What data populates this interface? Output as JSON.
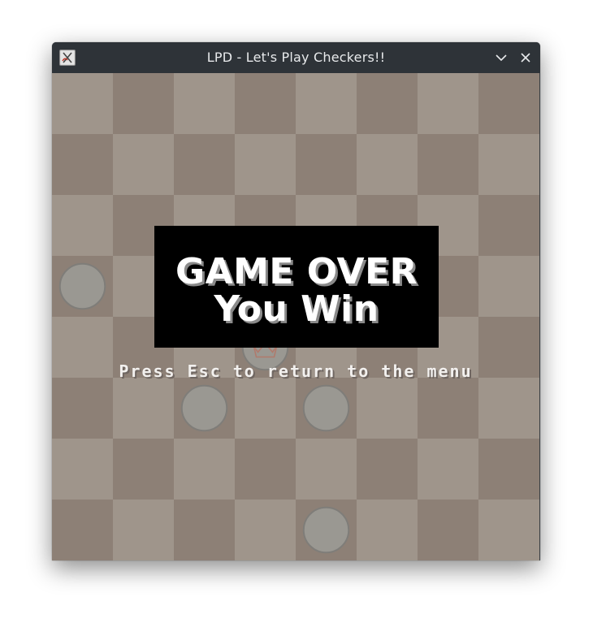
{
  "window": {
    "title": "LPD - Let's Play Checkers!!",
    "icon": "app-icon",
    "controls": [
      "minimize-chevron-icon",
      "close-icon"
    ]
  },
  "board": {
    "rows": 8,
    "cols": 8,
    "light_color": "#9f958b",
    "dark_color": "#8d8076",
    "piece_color": "#9a9892",
    "piece_border": "#7f7d79",
    "crown_color": "#b07a6c",
    "pieces": [
      {
        "row": 3,
        "col": 0,
        "king": false
      },
      {
        "row": 4,
        "col": 3,
        "king": true
      },
      {
        "row": 5,
        "col": 2,
        "king": false
      },
      {
        "row": 5,
        "col": 4,
        "king": false
      },
      {
        "row": 7,
        "col": 4,
        "king": false
      }
    ]
  },
  "overlay": {
    "line1": "GAME OVER",
    "line2": "You Win"
  },
  "hint": "Press Esc to return to the menu"
}
